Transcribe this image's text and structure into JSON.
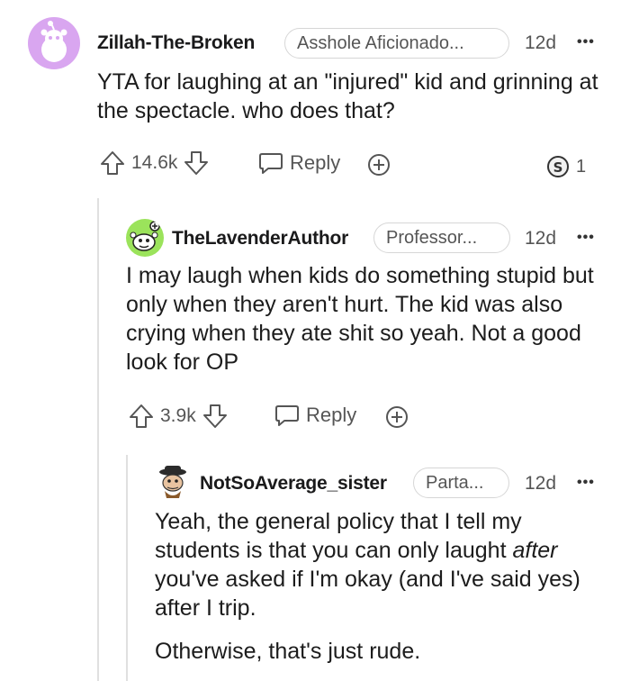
{
  "comments": [
    {
      "username": "Zillah-The-Broken",
      "flair": "Asshole Aficionado...",
      "time": "12d",
      "more": "•••",
      "body": [
        "YTA for laughing at an \"injured\" kid and grinning at the spectacle. who does that?"
      ],
      "score": "14.6k",
      "reply_label": "Reply",
      "award_count": "1"
    },
    {
      "username": "TheLavenderAuthor",
      "flair": "Professor...",
      "time": "12d",
      "more": "•••",
      "body": [
        "I may laugh when kids do something stupid but only when they aren't hurt. The kid was also crying when they ate shit so yeah. Not a good look for OP"
      ],
      "score": "3.9k",
      "reply_label": "Reply"
    },
    {
      "username": "NotSoAverage_sister",
      "flair": "Parta...",
      "time": "12d",
      "more": "•••",
      "body_p1_pre": "Yeah, the general policy that I tell my students is that you can only laught ",
      "body_p1_em": "after",
      "body_p1_post": " you've asked if I'm okay (and I've said yes) after I trip.",
      "body_p2": "Otherwise, that's just rude."
    }
  ],
  "colors": {
    "avatar1_bg": "#d9a6f0",
    "avatar2_bg": "#9be35b"
  },
  "icons": [
    "upvote-icon",
    "downvote-icon",
    "comment-icon",
    "add-award-icon",
    "award-badge-icon",
    "snoo-avatar-icon"
  ]
}
